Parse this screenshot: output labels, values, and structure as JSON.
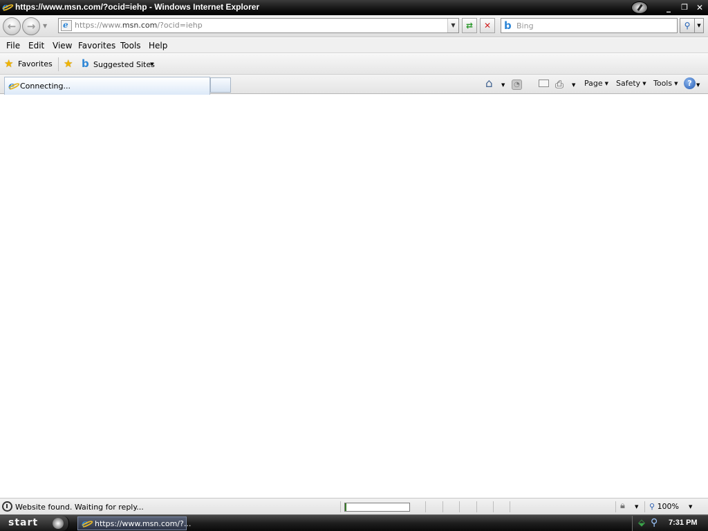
{
  "window": {
    "title": "https://www.msn.com/?ocid=iehp - Windows Internet Explorer",
    "minimize": "_",
    "restore": "❐",
    "close": "✕"
  },
  "address_bar": {
    "prefix": "https://www.",
    "domain": "msn.com",
    "suffix": "/?ocid=iehp"
  },
  "search": {
    "placeholder": "Bing",
    "provider_icon": "b"
  },
  "menu": [
    "File",
    "Edit",
    "View",
    "Favorites",
    "Tools",
    "Help"
  ],
  "favorites_bar": {
    "favorites_label": "Favorites",
    "suggested_sites_label": "Suggested Sites"
  },
  "tabs": [
    {
      "label": "Connecting..."
    }
  ],
  "command_bar": {
    "page": "Page",
    "safety": "Safety",
    "tools": "Tools"
  },
  "status_bar": {
    "text": "Website found. Waiting for reply...",
    "zoom": "100%",
    "progress": 0.02
  },
  "taskbar": {
    "start_label": "start",
    "task_label": "https://www.msn.com/?...",
    "clock": "7:31 PM"
  }
}
